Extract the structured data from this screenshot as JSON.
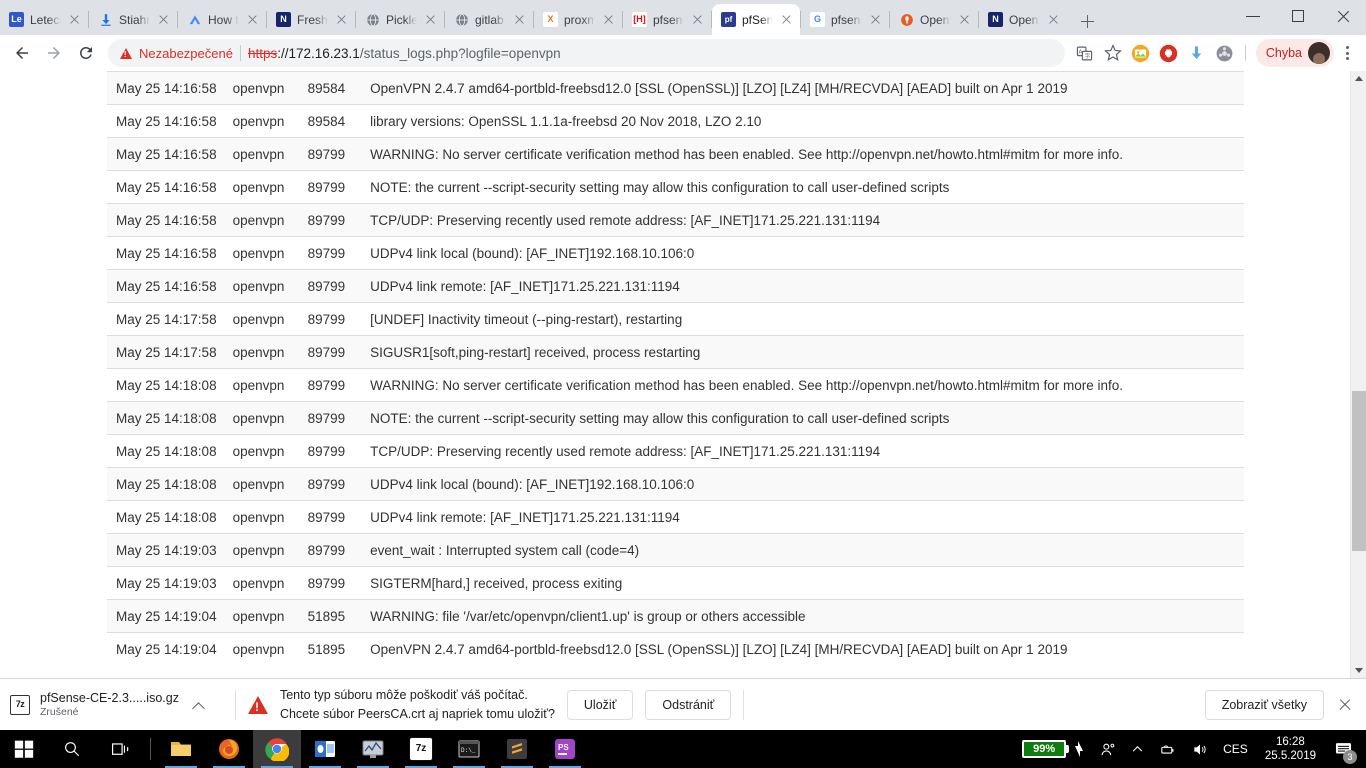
{
  "browser": {
    "tabs": [
      {
        "title": "Letecký",
        "icon": "Le",
        "icon_bg": "#2f58cd",
        "active": false
      },
      {
        "title": "Stiahnu",
        "icon": "download",
        "icon_bg": "#1a73e8",
        "active": false
      },
      {
        "title": "How to",
        "icon": "nordvpn",
        "icon_bg": "#ffffff",
        "active": false
      },
      {
        "title": "Fresh",
        "icon": "N",
        "icon_bg": "#16256b",
        "active": false
      },
      {
        "title": "Pickle",
        "icon": "globe",
        "icon_bg": "#ffffff",
        "active": false
      },
      {
        "title": "gitlab",
        "icon": "globe",
        "icon_bg": "#ffffff",
        "active": false
      },
      {
        "title": "proxmo",
        "icon": "X",
        "icon_bg": "#ffffff",
        "active": false
      },
      {
        "title": "pfsens",
        "icon": "[H]",
        "icon_bg": "#ffffff",
        "active": false
      },
      {
        "title": "pfSens",
        "icon": "pf",
        "icon_bg": "#2c3b8f",
        "active": true
      },
      {
        "title": "pfsens",
        "icon": "G",
        "icon_bg": "#ffffff",
        "active": false
      },
      {
        "title": "OpenV",
        "icon": "ovpn",
        "icon_bg": "#ffffff",
        "active": false
      },
      {
        "title": "OpenV",
        "icon": "N",
        "icon_bg": "#16256b",
        "active": false
      }
    ],
    "newtab_label": "+",
    "window_controls": {
      "minimize": "minimize",
      "maximize": "maximize",
      "close": "close"
    },
    "toolbar": {
      "back": "back",
      "forward": "forward",
      "reload": "reload",
      "security_label": "Nezabezpečené",
      "url_scheme": "https",
      "url_rest": "://172.16.23.1",
      "url_path": "/status_logs.php?logfile=openvpn",
      "profile_label": "Chyba"
    }
  },
  "log": {
    "columns": [
      "time",
      "process",
      "pid",
      "message"
    ],
    "rows": [
      [
        "May 25 14:16:58",
        "openvpn",
        "89584",
        "OpenVPN 2.4.7 amd64-portbld-freebsd12.0 [SSL (OpenSSL)] [LZO] [LZ4] [MH/RECVDA] [AEAD] built on Apr 1 2019"
      ],
      [
        "May 25 14:16:58",
        "openvpn",
        "89584",
        "library versions: OpenSSL 1.1.1a-freebsd 20 Nov 2018, LZO 2.10"
      ],
      [
        "May 25 14:16:58",
        "openvpn",
        "89799",
        "WARNING: No server certificate verification method has been enabled. See http://openvpn.net/howto.html#mitm for more info."
      ],
      [
        "May 25 14:16:58",
        "openvpn",
        "89799",
        "NOTE: the current --script-security setting may allow this configuration to call user-defined scripts"
      ],
      [
        "May 25 14:16:58",
        "openvpn",
        "89799",
        "TCP/UDP: Preserving recently used remote address: [AF_INET]171.25.221.131:1194"
      ],
      [
        "May 25 14:16:58",
        "openvpn",
        "89799",
        "UDPv4 link local (bound): [AF_INET]192.168.10.106:0"
      ],
      [
        "May 25 14:16:58",
        "openvpn",
        "89799",
        "UDPv4 link remote: [AF_INET]171.25.221.131:1194"
      ],
      [
        "May 25 14:17:58",
        "openvpn",
        "89799",
        "[UNDEF] Inactivity timeout (--ping-restart), restarting"
      ],
      [
        "May 25 14:17:58",
        "openvpn",
        "89799",
        "SIGUSR1[soft,ping-restart] received, process restarting"
      ],
      [
        "May 25 14:18:08",
        "openvpn",
        "89799",
        "WARNING: No server certificate verification method has been enabled. See http://openvpn.net/howto.html#mitm for more info."
      ],
      [
        "May 25 14:18:08",
        "openvpn",
        "89799",
        "NOTE: the current --script-security setting may allow this configuration to call user-defined scripts"
      ],
      [
        "May 25 14:18:08",
        "openvpn",
        "89799",
        "TCP/UDP: Preserving recently used remote address: [AF_INET]171.25.221.131:1194"
      ],
      [
        "May 25 14:18:08",
        "openvpn",
        "89799",
        "UDPv4 link local (bound): [AF_INET]192.168.10.106:0"
      ],
      [
        "May 25 14:18:08",
        "openvpn",
        "89799",
        "UDPv4 link remote: [AF_INET]171.25.221.131:1194"
      ],
      [
        "May 25 14:19:03",
        "openvpn",
        "89799",
        "event_wait : Interrupted system call (code=4)"
      ],
      [
        "May 25 14:19:03",
        "openvpn",
        "89799",
        "SIGTERM[hard,] received, process exiting"
      ],
      [
        "May 25 14:19:04",
        "openvpn",
        "51895",
        "WARNING: file '/var/etc/openvpn/client1.up' is group or others accessible"
      ],
      [
        "May 25 14:19:04",
        "openvpn",
        "51895",
        "OpenVPN 2.4.7 amd64-portbld-freebsd12.0 [SSL (OpenSSL)] [LZO] [LZ4] [MH/RECVDA] [AEAD] built on Apr 1 2019"
      ]
    ]
  },
  "download_shelf": {
    "file_name": "pfSense-CE-2.3.....iso.gz",
    "file_status": "Zrušené",
    "file_icon_label": "7z",
    "warning_line1": "Tento typ súboru môže poškodiť váš počítač.",
    "warning_line2": "Chcete súbor PeersCA.crt aj napriek tomu uložiť?",
    "save_label": "Uložiť",
    "discard_label": "Odstrániť",
    "show_all_label": "Zobraziť všetky"
  },
  "taskbar": {
    "start": "windows-start",
    "search": "search",
    "taskview": "task-view",
    "apps": [
      {
        "name": "file-explorer",
        "label": "",
        "bg": "#e8b341",
        "running": true
      },
      {
        "name": "firefox",
        "label": "",
        "bg": "#e8661d",
        "running": true
      },
      {
        "name": "google-chrome",
        "label": "",
        "bg": "#ffffff",
        "running": true,
        "active": true
      },
      {
        "name": "outlook",
        "label": "",
        "bg": "#2b6fd1",
        "running": true
      },
      {
        "name": "system-monitor",
        "label": "",
        "bg": "#b7bcc4",
        "running": true
      },
      {
        "name": "7zip",
        "label": "7z",
        "bg": "#ffffff",
        "running": true
      },
      {
        "name": "terminal",
        "label": "",
        "bg": "#1a1a1a",
        "running": true
      },
      {
        "name": "sublime-text",
        "label": "S",
        "bg": "#3d3d3d",
        "running": true
      },
      {
        "name": "phpstorm",
        "label": "PS",
        "bg": "#a244c7",
        "running": true
      }
    ],
    "tray": {
      "battery_percent": "99%",
      "language": "CES",
      "time": "16:28",
      "date": "25.5.2019",
      "notification_count": "3"
    }
  }
}
